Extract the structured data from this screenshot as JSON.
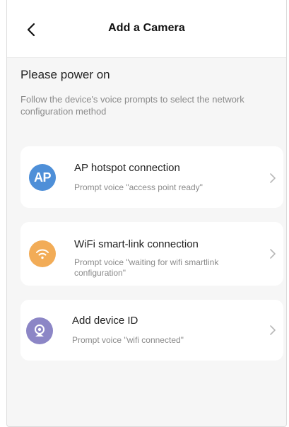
{
  "header": {
    "title": "Add a Camera",
    "back_icon": "chevron-left-icon"
  },
  "intro": {
    "title": "Please power on",
    "description": "Follow the device's voice prompts to select the network configuration method"
  },
  "options": [
    {
      "icon": "ap-icon",
      "icon_text": "AP",
      "icon_color": "#4e8fd8",
      "title": "AP hotspot connection",
      "description": "Prompt voice \"access point ready\""
    },
    {
      "icon": "wifi-icon",
      "icon_color": "#f2ac57",
      "title": "WiFi smart-link connection",
      "description": "Prompt voice \"waiting for wifi smartlink configuration\""
    },
    {
      "icon": "device-id-icon",
      "icon_color": "#8c86c6",
      "title": "Add device ID",
      "description": "Prompt voice \"wifi connected\""
    }
  ],
  "chevron_icon": "chevron-right-icon"
}
